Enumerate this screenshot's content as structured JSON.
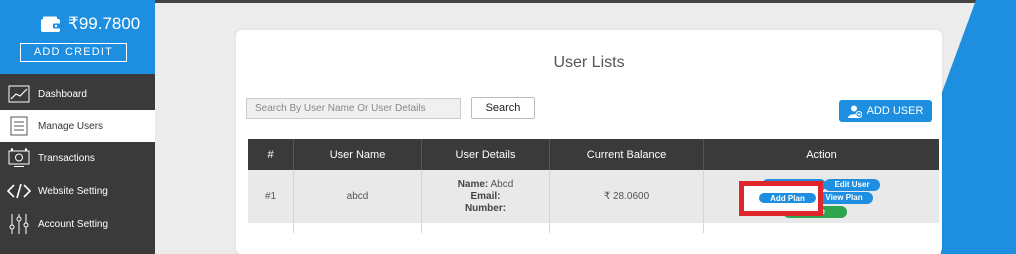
{
  "wallet": {
    "balance": "₹99.7800",
    "add_credit": "ADD CREDIT"
  },
  "nav": [
    {
      "label": "Dashboard",
      "icon": "dashboard-chart-icon"
    },
    {
      "label": "Manage Users",
      "icon": "users-list-icon"
    },
    {
      "label": "Transactions",
      "icon": "transactions-icon"
    },
    {
      "label": "Website Setting",
      "icon": "code-icon"
    },
    {
      "label": "Account Setting",
      "icon": "sliders-icon"
    }
  ],
  "page": {
    "title": "User Lists",
    "search_placeholder": "Search By User Name Or User Details",
    "search_button": "Search",
    "add_user_button": "ADD USER"
  },
  "table": {
    "columns": [
      "#",
      "User Name",
      "User Details",
      "Current Balance",
      "Action"
    ],
    "rows": [
      {
        "index": "#1",
        "user_name": "abcd",
        "details": {
          "name_label": "Name:",
          "name_value": "Abcd",
          "email_label": "Email:",
          "number_label": "Number:"
        },
        "balance": "₹ 28.0600",
        "actions": {
          "edit_user": "Edit User",
          "add_plan": "Add Plan",
          "view_plan": "View Plan",
          "active_partial": "ve"
        }
      }
    ]
  },
  "colors": {
    "primary": "#1e8fe0",
    "sidebar": "#3a3a3a",
    "highlight_box": "#e0262b",
    "success": "#2ea44f"
  }
}
